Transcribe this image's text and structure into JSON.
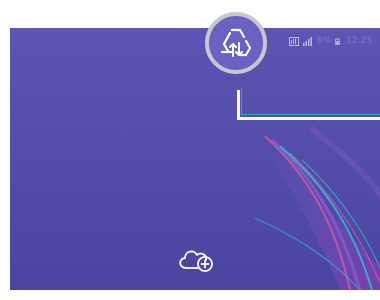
{
  "screen": {
    "background_color": "#5b55b3",
    "accent_colors": [
      "#e05aa8",
      "#2fb8d8",
      "#8a5cc8"
    ]
  },
  "status_bar": {
    "icons": [
      "hd-icon",
      "signal-icon",
      "battery-icon"
    ],
    "time_text": "12:25",
    "battery_text": "8%"
  },
  "zoom_callout": {
    "icon": "data-saver-icon",
    "ring_color": "#c9c6cf",
    "fill_color": "#6a62c2"
  },
  "highlight": {
    "line_color": "#ffffff",
    "inner_color": "#2aa8c8"
  },
  "cloud_button": {
    "icon": "cloud-upload-icon"
  }
}
